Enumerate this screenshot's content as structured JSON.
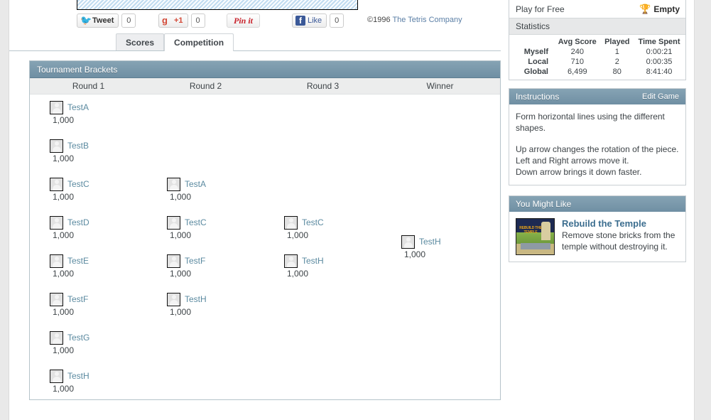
{
  "social": {
    "tweet_label": "Tweet",
    "tweet_count": "0",
    "gplus_label": "+1",
    "gplus_count": "0",
    "pinit_label": "Pin it",
    "like_label": "Like",
    "like_count": "0"
  },
  "copyright": {
    "prefix": "©1996 ",
    "company": "The Tetris Company"
  },
  "tabs": [
    {
      "label": "Scores",
      "active": false
    },
    {
      "label": "Competition",
      "active": true
    }
  ],
  "brackets": {
    "title": "Tournament Brackets",
    "columns": [
      "Round 1",
      "Round 2",
      "Round 3",
      "Winner"
    ],
    "round1": [
      {
        "name": "TestA",
        "score": "1,000"
      },
      {
        "name": "TestB",
        "score": "1,000"
      },
      {
        "name": "TestC",
        "score": "1,000"
      },
      {
        "name": "TestD",
        "score": "1,000"
      },
      {
        "name": "TestE",
        "score": "1,000"
      },
      {
        "name": "TestF",
        "score": "1,000"
      },
      {
        "name": "TestG",
        "score": "1,000"
      },
      {
        "name": "TestH",
        "score": "1,000"
      }
    ],
    "round2": [
      {
        "name": "TestA",
        "score": "1,000"
      },
      {
        "name": "TestC",
        "score": "1,000"
      },
      {
        "name": "TestF",
        "score": "1,000"
      },
      {
        "name": "TestH",
        "score": "1,000"
      }
    ],
    "round3": [
      {
        "name": "TestC",
        "score": "1,000"
      },
      {
        "name": "TestH",
        "score": "1,000"
      }
    ],
    "winner": [
      {
        "name": "TestH",
        "score": "1,000"
      }
    ]
  },
  "sidebar": {
    "play_for_free": "Play for Free",
    "trophy_status": "Empty",
    "statistics": {
      "heading": "Statistics",
      "columns": [
        "Avg Score",
        "Played",
        "Time Spent"
      ],
      "rows": [
        {
          "label": "Myself",
          "avg_score": "240",
          "played": "1",
          "time_spent": "0:00:21"
        },
        {
          "label": "Local",
          "avg_score": "710",
          "played": "2",
          "time_spent": "0:00:35"
        },
        {
          "label": "Global",
          "avg_score": "6,499",
          "played": "80",
          "time_spent": "8:41:40"
        }
      ]
    },
    "instructions": {
      "heading": "Instructions",
      "edit_label": "Edit Game",
      "p1": "Form horizontal lines using the different shapes.",
      "p2": "Up arrow changes the rotation of the piece.",
      "p3": "Left and Right arrows move it.",
      "p4": "Down arrow brings it down faster."
    },
    "you_might_like": {
      "heading": "You Might Like",
      "game_title": "Rebuild the Temple",
      "game_desc": "Remove stone bricks from the temple without destroying it.",
      "thumb_text": "REBUILD THE TEMPLE"
    }
  }
}
